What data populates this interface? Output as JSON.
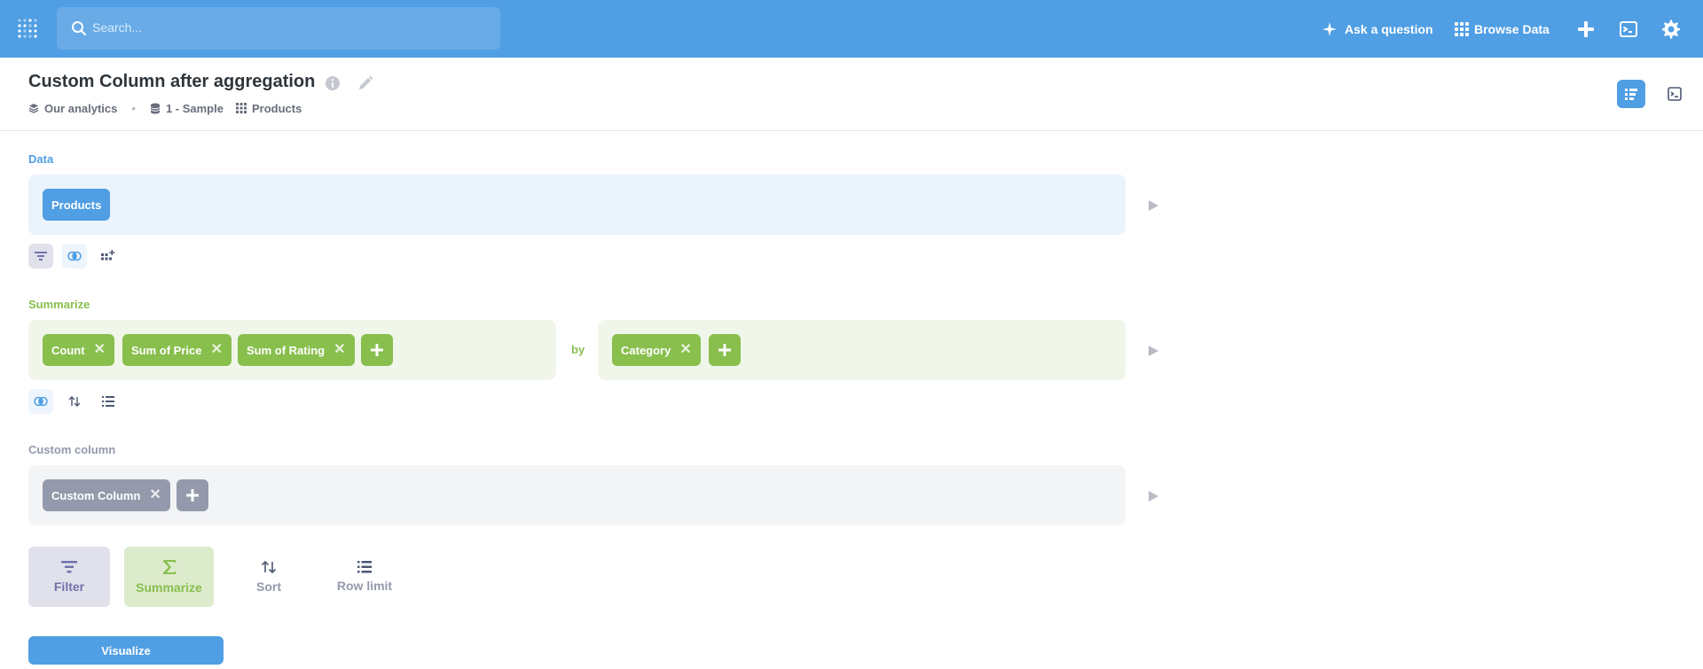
{
  "nav": {
    "search_placeholder": "Search...",
    "ask_question": "Ask a question",
    "browse_data": "Browse Data"
  },
  "header": {
    "title": "Custom Column after aggregation",
    "breadcrumbs": [
      "Our analytics",
      "1 - Sample",
      "Products"
    ]
  },
  "data_step": {
    "label": "Data",
    "table": "Products"
  },
  "summarize_step": {
    "label": "Summarize",
    "metrics": [
      "Count",
      "Sum of Price",
      "Sum of Rating"
    ],
    "by_label": "by",
    "breakouts": [
      "Category"
    ]
  },
  "custom_column_step": {
    "label": "Custom column",
    "columns": [
      "Custom Column"
    ]
  },
  "actions": {
    "filter": "Filter",
    "summarize": "Summarize",
    "sort": "Sort",
    "row_limit": "Row limit"
  },
  "visualize_label": "Visualize",
  "colors": {
    "brand": "#509ee3",
    "summarize": "#88bf4d",
    "filter": "#7172ad",
    "custom_column": "#949aab"
  }
}
